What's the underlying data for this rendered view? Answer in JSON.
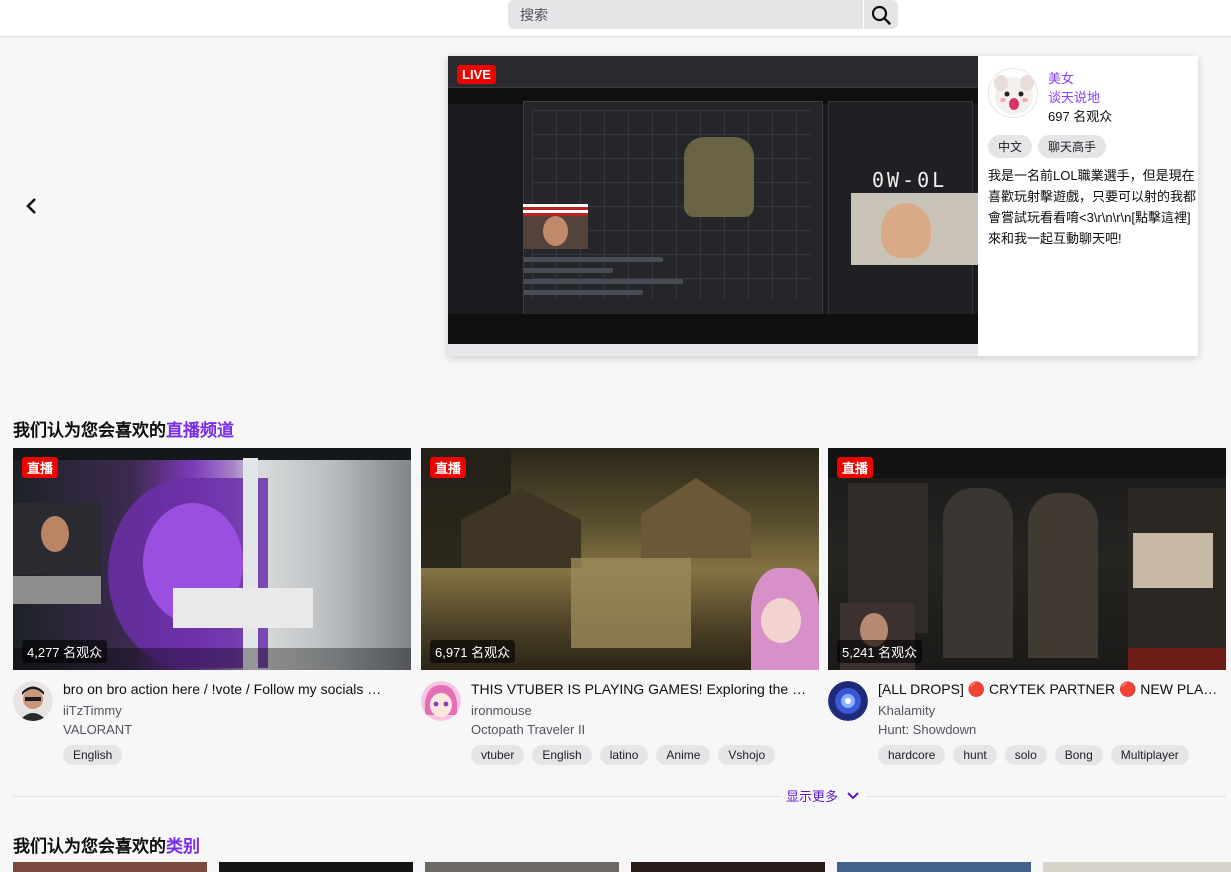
{
  "search": {
    "placeholder": "搜索"
  },
  "featured": {
    "live_label": "LIVE",
    "overlay_score": "0W-0L",
    "channel_name": "美女",
    "category": "谈天说地",
    "viewers": "697 名观众",
    "tags": [
      "中文",
      "聊天高手"
    ],
    "description": "我是一名前LOL職業選手，但是現在喜歡玩射擊遊戲，只要可以射的我都會嘗試玩看看唷<3\\r\\n\\r\\n[點擊這裡] 來和我一起互動聊天吧!"
  },
  "live_section": {
    "title_prefix": "我们认为您会喜欢的",
    "title_accent": "直播频道"
  },
  "live_label": "直播",
  "streams": [
    {
      "viewers": "4,277 名观众",
      "title": "bro on bro action here / !vote / Follow my socials …",
      "channel": "iiTzTimmy",
      "game": "VALORANT",
      "tags": [
        "English"
      ]
    },
    {
      "viewers": "6,971 名观众",
      "title": "THIS VTUBER IS PLAYING GAMES! Exploring the …",
      "channel": "ironmouse",
      "game": "Octopath Traveler II",
      "tags": [
        "vtuber",
        "English",
        "latino",
        "Anime",
        "Vshojo"
      ]
    },
    {
      "viewers": "5,241 名观众",
      "title": "[ALL DROPS] 🔴 CRYTEK PARTNER 🔴 NEW PLA…",
      "channel": "Khalamity",
      "game": "Hunt: Showdown",
      "tags": [
        "hardcore",
        "hunt",
        "solo",
        "Bong",
        "Multiplayer"
      ]
    }
  ],
  "show_more": "显示更多",
  "category_section": {
    "title_prefix": "我们认为您会喜欢的",
    "title_accent": "类别"
  },
  "colors": {
    "accent": "#772ce8",
    "live_red": "#eb0400"
  }
}
